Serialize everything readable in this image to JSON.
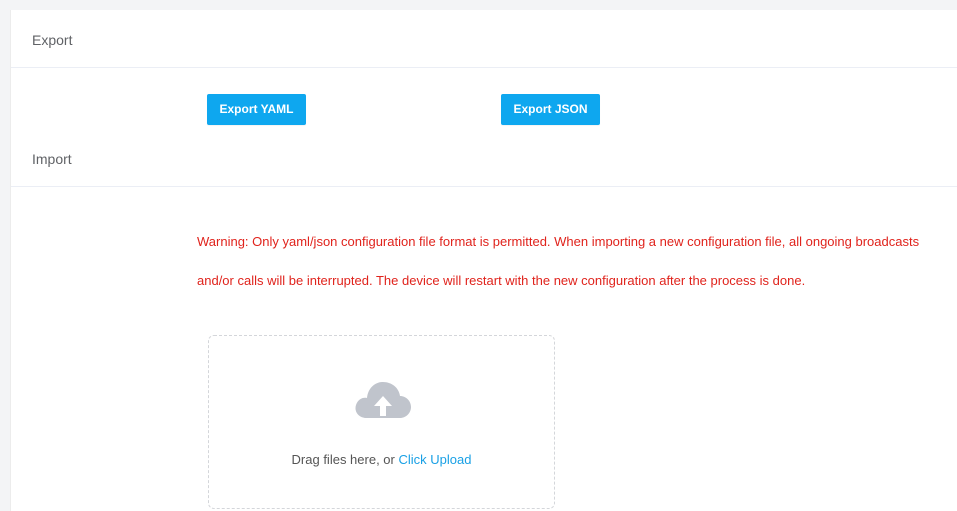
{
  "export": {
    "title": "Export",
    "yaml_label": "Export YAML",
    "json_label": "Export JSON"
  },
  "import": {
    "title": "Import",
    "warning_line1": "Warning: Only yaml/json configuration file format is permitted. When importing a new configuration file, all ongoing broadcasts",
    "warning_line2": "and/or calls will be interrupted. The device will restart with the new configuration after the process is done.",
    "upload_prompt": "Drag files here, or ",
    "upload_link": "Click Upload",
    "upload_icon": "cloud-upload-icon"
  },
  "colors": {
    "accent": "#0ea7ef",
    "warning": "#e0231c",
    "link": "#19a0e5"
  }
}
